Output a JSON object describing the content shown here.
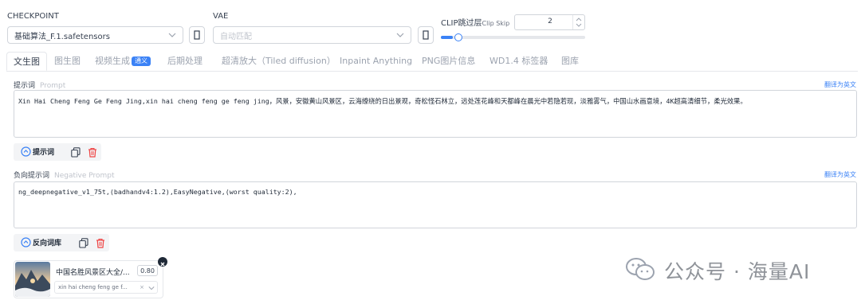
{
  "checkpoint": {
    "label": "CHECKPOINT",
    "value": "基础算法_F.1.safetensors"
  },
  "vae": {
    "label": "VAE",
    "value": "自动匹配"
  },
  "clip_skip": {
    "label": "CLIP跳过层",
    "sublabel": "Clip Skip",
    "value": "2",
    "slider_level": 0.05
  },
  "tabs": [
    {
      "label": "文生图"
    },
    {
      "label": "图生图"
    },
    {
      "label": "视频生成",
      "badge": "通义"
    },
    {
      "label": "后期处理"
    },
    {
      "label": "超清放大（Tiled diffusion）"
    },
    {
      "label": "Inpaint Anything"
    },
    {
      "label": "PNG图片信息"
    },
    {
      "label": "WD1.4 标签器"
    },
    {
      "label": "图库"
    }
  ],
  "prompt": {
    "label": "提示词",
    "sublabel": "Prompt",
    "translate": "翻译为英文",
    "text": "Xin Hai Cheng Feng Ge Feng Jing,xin hai cheng feng ge feng jing，风景，安徽黄山风景区，云海缭绕的日出景观，奇松怪石林立，远处莲花峰和天都峰在晨光中若隐若现，淡雅雾气，中国山水画意境，4K超高清细节，柔光效果。",
    "toggle_label": "提示词"
  },
  "negative_prompt": {
    "label": "负向提示词",
    "sublabel": "Negative Prompt",
    "translate": "翻译为英文",
    "text": "ng_deepnegative_v1_75t,(badhandv4:1.2),EasyNegative,(worst quality:2),",
    "toggle_label": "反向词库"
  },
  "lora_card": {
    "title": "中国名胜风景区大全/...",
    "weight": "0.80",
    "trigger": "xin hai cheng feng ge f..."
  },
  "watermark": {
    "text": "公众号 · 海量AI"
  },
  "colors": {
    "accent": "#3b82f6",
    "danger": "#ef4444"
  }
}
